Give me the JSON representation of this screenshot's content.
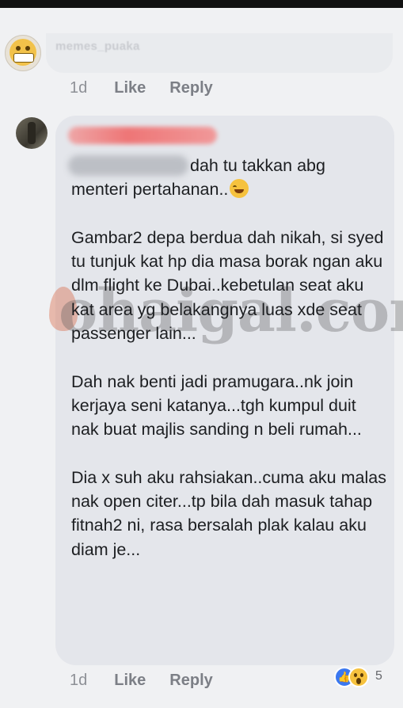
{
  "comments": [
    {
      "author": "memes_puaka",
      "time": "1d",
      "like_label": "Like",
      "reply_label": "Reply"
    },
    {
      "lines": {
        "l1": "dah tu takkan abg",
        "l2": "menteri pertahanan..",
        "p2": "Gambar2 depa berdua dah nikah, si syed tu tunjuk kat hp dia masa borak ngan aku dlm flight ke Dubai..kebetulan seat aku kat area yg belakangnya luas xde seat passenger lain...",
        "p3": "Dah nak benti jadi pramugara..nk join kerjaya seni katanya...tgh kumpul duit nak buat majlis sanding n beli rumah...",
        "p4": "Dia x suh aku rahsiakan..cuma aku malas nak open citer...tp bila dah masuk tahap fitnah2 ni, rasa bersalah plak kalau aku diam je..."
      },
      "time": "1d",
      "like_label": "Like",
      "reply_label": "Reply",
      "reactions": {
        "icons": [
          "like-icon",
          "wow-icon"
        ],
        "count": "5"
      }
    }
  ],
  "watermark": "ohaigal.com"
}
